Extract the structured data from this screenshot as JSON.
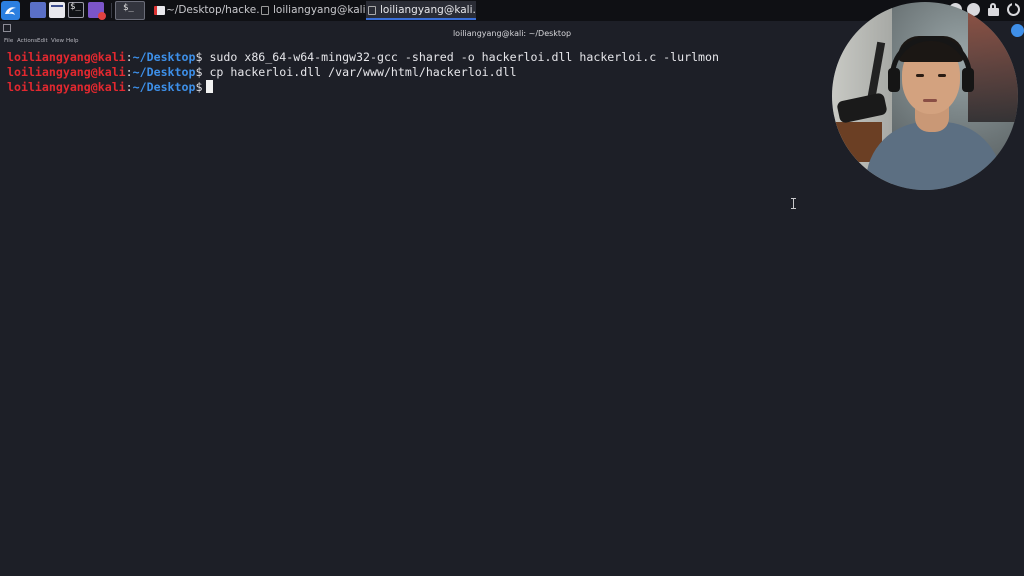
{
  "taskbar": {
    "tasks": [
      {
        "label": "~/Desktop/hacke..."
      },
      {
        "label": "loiliangyang@kali..."
      },
      {
        "label": "loiliangyang@kali..."
      }
    ]
  },
  "window": {
    "title": "loiliangyang@kali: ~/Desktop",
    "menu": [
      "File",
      "Actions",
      "Edit",
      "View",
      "Help"
    ]
  },
  "terminal": {
    "lines": [
      {
        "user": "loiliangyang@kali",
        "sep": ":",
        "path": "~/Desktop",
        "prompt": "$",
        "command": " sudo x86_64-w64-mingw32-gcc -shared -o hackerloi.dll hackerloi.c -lurlmon"
      },
      {
        "user": "loiliangyang@kali",
        "sep": ":",
        "path": "~/Desktop",
        "prompt": "$",
        "command": " cp hackerloi.dll /var/www/html/hackerloi.dll"
      },
      {
        "user": "loiliangyang@kali",
        "sep": ":",
        "path": "~/Desktop",
        "prompt": "$",
        "command": ""
      }
    ]
  },
  "colors": {
    "background": "#1d1f27",
    "user": "#e3282f",
    "path": "#3d8fe8",
    "accent": "#2b7fe0"
  },
  "icons": [
    "kali-menu-icon",
    "workspace-icon",
    "file-manager-icon",
    "terminal-icon",
    "firefox-icon",
    "lock-icon",
    "power-icon"
  ]
}
